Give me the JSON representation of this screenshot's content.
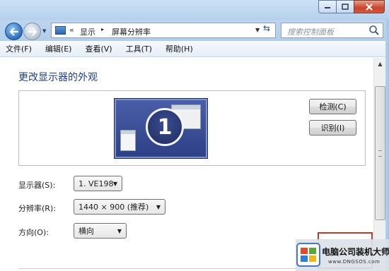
{
  "titlebar": {
    "minimize_icon": "minimize-icon",
    "maximize_icon": "maximize-icon",
    "close_icon": "close-icon"
  },
  "nav": {
    "back_icon": "back-arrow-icon",
    "forward_icon": "forward-arrow-icon",
    "address": {
      "chevrons": "«",
      "segment1": "显示",
      "separator": "▸",
      "segment2": "屏幕分辨率",
      "dropdown": "▼",
      "refresh_glyph": "⇆"
    },
    "search_placeholder": "搜索控制面板"
  },
  "menu": {
    "items": [
      "文件(F)",
      "编辑(E)",
      "查看(V)",
      "工具(T)",
      "帮助(H)"
    ]
  },
  "main": {
    "title": "更改显示器的外观",
    "monitor_number": "1",
    "detect_button": "检测(C)",
    "identify_button": "识别(I)",
    "display_label": "显示器(S):",
    "display_value": "1. VE198",
    "resolution_label": "分辨率(R):",
    "resolution_value": "1440 × 900 (推荐)",
    "orientation_label": "方向(O):",
    "orientation_value": "横向",
    "dropdown_arrow": "▼"
  },
  "watermark": {
    "title": "电脑公司装机大师",
    "url": "www.DNGSOS.com"
  },
  "colors": {
    "title_blue": "#1d3d8b",
    "close_red": "#c8432c",
    "monitor_blue": "#2d3f85",
    "highlight_red": "#c0392b"
  }
}
